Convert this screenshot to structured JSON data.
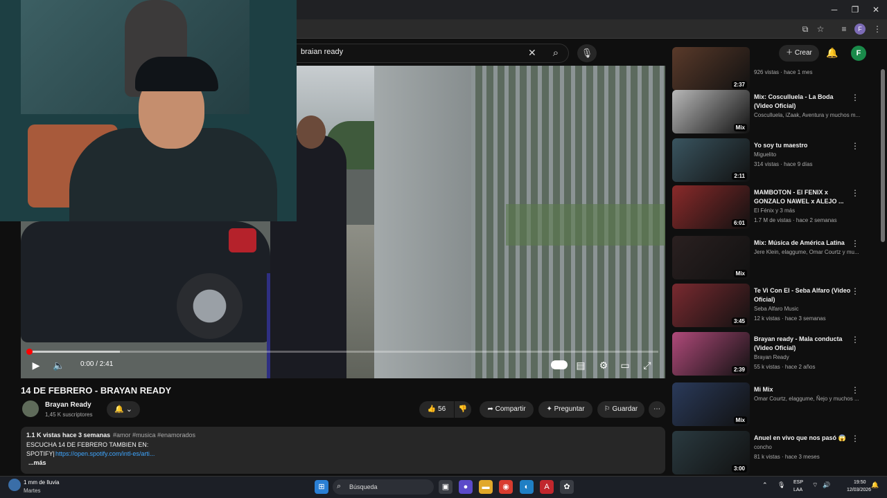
{
  "browser": {
    "minimize": "─",
    "maximize": "❐",
    "close": "✕",
    "profile_initial": "F"
  },
  "header": {
    "search_value": "braian ready",
    "create_label": "Crear",
    "avatar_initial": "F"
  },
  "player": {
    "time": "0:00 / 2:41",
    "progress_fraction": 0.0
  },
  "video": {
    "title": "14 DE FEBRERO - BRAYAN READY",
    "channel": "Brayan Ready",
    "subscribers": "1,45 K suscriptores",
    "likes": "56",
    "share_label": "Compartir",
    "ask_label": "Preguntar",
    "save_label": "Guardar"
  },
  "description": {
    "stats": "1.1 K vistas  hace 3 semanas",
    "tags": "#amor #musica #enamorados",
    "line1": "ESCUCHA 14 DE FEBRERO TAMBIEN EN:",
    "line2_prefix": "SPOTIFY|",
    "link": "https://open.spotify.com/intl-es/arti...",
    "more": "...más"
  },
  "recommendations": [
    {
      "title": "",
      "channel": "",
      "meta": "926 vistas · hace 1 mes",
      "duration": "2:37",
      "color": "#5a3a2a"
    },
    {
      "title": "Mix: Cosculluela - La Boda (Video Oficial)",
      "channel": "Cosculluela, iZaak, Aventura y muchos m...",
      "meta": "",
      "duration": "Mix",
      "color": "#b8b8b8"
    },
    {
      "title": "Yo soy tu maestro",
      "channel": "Miguelito",
      "meta": "314 vistas · hace 9 días",
      "duration": "2:11",
      "color": "#3a5560"
    },
    {
      "title": "MAMBOTON - El FENIX x GONZALO NAWEL x ALEJO ...",
      "channel": "El Fénix y 3 más",
      "meta": "1.7 M de vistas · hace 2 semanas",
      "duration": "6:01",
      "color": "#8a2a2a"
    },
    {
      "title": "Mix: Música de América Latina",
      "channel": "Jere Klein, elaggume, Omar Courtz y mu...",
      "meta": "",
      "duration": "Mix",
      "color": "#2a2020"
    },
    {
      "title": "Te Vi Con El - Seba Alfaro (Video Oficial)",
      "channel": "Seba Alfaro Music",
      "meta": "12 k vistas · hace 3 semanas",
      "duration": "3:45",
      "color": "#7a2a30"
    },
    {
      "title": "Brayan ready - Mala conducta (Video Oficial)",
      "channel": "Brayan Ready",
      "meta": "55 k vistas · hace 2 años",
      "duration": "2:39",
      "color": "#b04a7a"
    },
    {
      "title": "Mi Mix",
      "channel": "Omar Courtz, elaggume, Ñejo y muchos ...",
      "meta": "",
      "duration": "Mix",
      "color": "#2a3a5a"
    },
    {
      "title": "Anuel en vivo que nos pasó 😱",
      "channel": "concho",
      "meta": "81 k vistas · hace 3 meses",
      "duration": "3:00",
      "color": "#2a3a40"
    }
  ],
  "taskbar": {
    "weather": "1 mm de lluvia",
    "day": "Martes",
    "search": "Búsqueda",
    "lang1": "ESP",
    "lang2": "LAA",
    "time": "19:50",
    "date": "12/03/2026"
  }
}
